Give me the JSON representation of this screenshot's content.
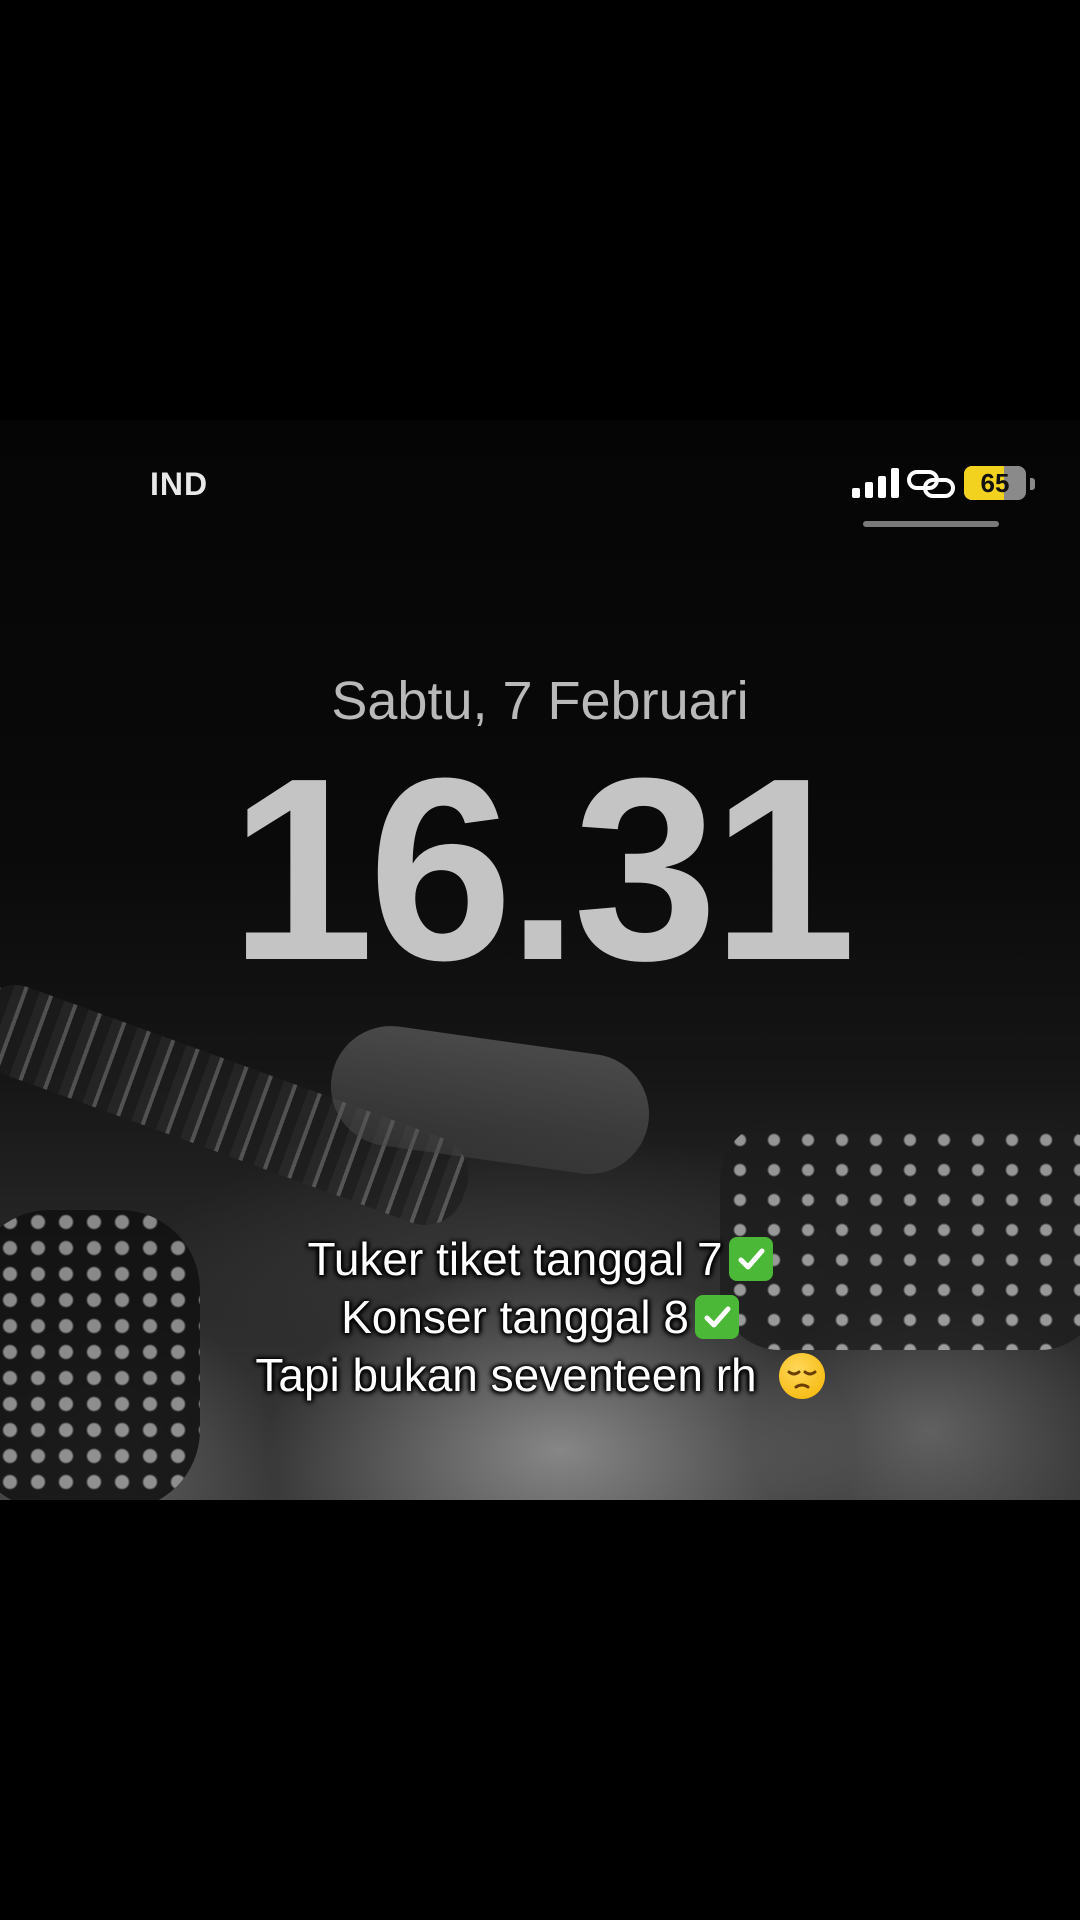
{
  "status_bar": {
    "carrier": "IND",
    "battery_level": "65",
    "battery_fraction": 0.65,
    "icons": [
      "signal-icon",
      "personal-hotspot-icon"
    ],
    "battery_color": "#f2d21f"
  },
  "lockscreen": {
    "date": "Sabtu, 7 Februari",
    "time": "16.31"
  },
  "caption": {
    "lines": [
      {
        "text": "Tuker tiket tanggal 7",
        "emoji": "check-mark-icon"
      },
      {
        "text": "Konser tanggal 8",
        "emoji": "check-mark-icon"
      },
      {
        "text": "Tapi bukan seventeen rh",
        "emoji": "pensive-face-icon"
      }
    ],
    "check_color": "#4cb838"
  }
}
